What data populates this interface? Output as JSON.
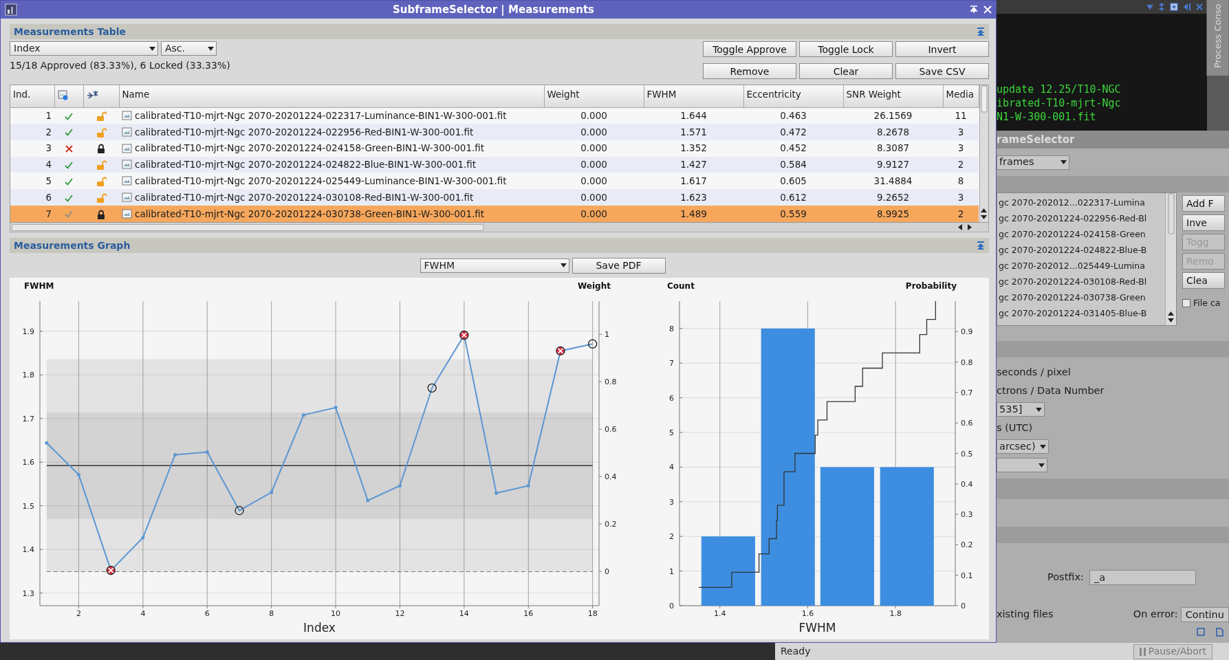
{
  "window": {
    "title": "SubframeSelector | Measurements"
  },
  "table_section": {
    "title": "Measurements Table",
    "sort_field": "Index",
    "sort_order": "Asc.",
    "buttons": [
      {
        "label": "Toggle Approve"
      },
      {
        "label": "Toggle Lock"
      },
      {
        "label": "Invert"
      },
      {
        "label": "Remove"
      },
      {
        "label": "Clear"
      },
      {
        "label": "Save CSV"
      }
    ],
    "summary": "15/18 Approved (83.33%), 6 Locked (33.33%)",
    "columns": [
      {
        "kind": "index",
        "label": "Ind."
      },
      {
        "kind": "approval"
      },
      {
        "kind": "lock"
      },
      {
        "kind": "file",
        "label": "Name"
      },
      {
        "kind": "value",
        "label": "Weight"
      },
      {
        "kind": "value",
        "label": "FWHM"
      },
      {
        "kind": "value",
        "label": "Eccentricity"
      },
      {
        "kind": "value",
        "label": "SNR Weight"
      },
      {
        "kind": "value",
        "label": "Media"
      }
    ],
    "rows": [
      {
        "approved": true,
        "locked": false,
        "selected": false,
        "cells": [
          "1",
          "",
          "",
          "calibrated-T10-mjrt-Ngc 2070-20201224-022317-Luminance-BIN1-W-300-001.fit",
          "0.000",
          "1.644",
          "0.463",
          "26.1569",
          "11"
        ]
      },
      {
        "approved": true,
        "locked": false,
        "selected": false,
        "cells": [
          "2",
          "",
          "",
          "calibrated-T10-mjrt-Ngc 2070-20201224-022956-Red-BIN1-W-300-001.fit",
          "0.000",
          "1.571",
          "0.472",
          "8.2678",
          "3"
        ]
      },
      {
        "approved": false,
        "locked": true,
        "selected": false,
        "cells": [
          "3",
          "",
          "",
          "calibrated-T10-mjrt-Ngc 2070-20201224-024158-Green-BIN1-W-300-001.fit",
          "0.000",
          "1.352",
          "0.452",
          "8.3087",
          "3"
        ]
      },
      {
        "approved": true,
        "locked": false,
        "selected": false,
        "cells": [
          "4",
          "",
          "",
          "calibrated-T10-mjrt-Ngc 2070-20201224-024822-Blue-BIN1-W-300-001.fit",
          "0.000",
          "1.427",
          "0.584",
          "9.9127",
          "2"
        ]
      },
      {
        "approved": true,
        "locked": false,
        "selected": false,
        "cells": [
          "5",
          "",
          "",
          "calibrated-T10-mjrt-Ngc 2070-20201224-025449-Luminance-BIN1-W-300-001.fit",
          "0.000",
          "1.617",
          "0.605",
          "31.4884",
          "8"
        ]
      },
      {
        "approved": true,
        "locked": false,
        "selected": false,
        "cells": [
          "6",
          "",
          "",
          "calibrated-T10-mjrt-Ngc 2070-20201224-030108-Red-BIN1-W-300-001.fit",
          "0.000",
          "1.623",
          "0.612",
          "9.2652",
          "3"
        ]
      },
      {
        "approved": true,
        "locked": true,
        "selected": true,
        "cells": [
          "7",
          "",
          "",
          "calibrated-T10-mjrt-Ngc 2070-20201224-030738-Green-BIN1-W-300-001.fit",
          "0.000",
          "1.489",
          "0.559",
          "8.9925",
          "2"
        ]
      }
    ]
  },
  "graph_section": {
    "title": "Measurements Graph",
    "property": "FWHM",
    "save_button": "Save PDF",
    "line_chart": {
      "chart_data": {
        "type": "line",
        "ylabel": "FWHM",
        "xlabel": "Index",
        "x": [
          1,
          2,
          3,
          4,
          5,
          6,
          7,
          8,
          9,
          10,
          11,
          12,
          13,
          14,
          15,
          16,
          17,
          18
        ],
        "series": [
          {
            "color": "#5b96d2",
            "values": [
              1.644,
              1.571,
              1.352,
              1.427,
              1.617,
              1.623,
              1.489,
              1.531,
              1.708,
              1.725,
              1.512,
              1.546,
              1.77,
              1.891,
              1.529,
              1.546,
              1.855,
              1.871
            ]
          }
        ],
        "xlim": [
          0.79,
          18.2
        ],
        "ylim": [
          1.271,
          1.969
        ],
        "xticks": [
          2,
          4,
          6,
          8,
          10,
          12,
          14,
          16,
          18
        ],
        "yticks": [
          1.3,
          1.4,
          1.5,
          1.6,
          1.7,
          1.8,
          1.9
        ],
        "y2label": "Weight",
        "y2lim": [
          -0.145,
          1.14
        ],
        "y2ticks": [
          0,
          0.2,
          0.4,
          0.6,
          0.8,
          1
        ],
        "grid": true,
        "ref_lines": [
          {
            "axis": "y",
            "value": 1.592
          },
          {
            "axis": "y",
            "value": 1.349
          }
        ],
        "bands": [
          {
            "axis": "y",
            "from": 1.349,
            "to": 1.836
          },
          {
            "axis": "y",
            "from": 1.47,
            "to": 1.714
          }
        ]
      },
      "points": [
        {
          "approved": true,
          "locked": false
        },
        {
          "approved": true,
          "locked": false
        },
        {
          "approved": false,
          "locked": true
        },
        {
          "approved": true,
          "locked": false
        },
        {
          "approved": true,
          "locked": false
        },
        {
          "approved": true,
          "locked": false
        },
        {
          "approved": true,
          "locked": true
        },
        {
          "approved": true,
          "locked": false
        },
        {
          "approved": true,
          "locked": false
        },
        {
          "approved": true,
          "locked": false
        },
        {
          "approved": true,
          "locked": false
        },
        {
          "approved": true,
          "locked": false
        },
        {
          "approved": true,
          "locked": true
        },
        {
          "approved": false,
          "locked": true
        },
        {
          "approved": true,
          "locked": false
        },
        {
          "approved": true,
          "locked": false
        },
        {
          "approved": false,
          "locked": true
        },
        {
          "approved": true,
          "locked": true
        }
      ]
    },
    "histogram": {
      "chart_data": {
        "type": "bar",
        "ylabel": "Count",
        "xlabel": "FWHM",
        "x": [
          1.419,
          1.555,
          1.69,
          1.826
        ],
        "series": [
          {
            "color": "#3d8ee0",
            "values": [
              2,
              8,
              4,
              4
            ]
          }
        ],
        "xlim": [
          1.308,
          1.936
        ],
        "ylim": [
          0,
          8.79
        ],
        "xticks": [
          1.4,
          1.6,
          1.8
        ],
        "yticks": [
          0,
          1,
          2,
          3,
          4,
          5,
          6,
          7,
          8
        ],
        "grid": true
      }
    },
    "cumulative": {
      "chart_data": {
        "type": "line",
        "ylabel": "Probability",
        "x": [
          1.352,
          1.427,
          1.427,
          1.489,
          1.489,
          1.512,
          1.512,
          1.529,
          1.529,
          1.531,
          1.531,
          1.546,
          1.546,
          1.571,
          1.571,
          1.617,
          1.617,
          1.623,
          1.623,
          1.644,
          1.644,
          1.708,
          1.708,
          1.725,
          1.725,
          1.77,
          1.77,
          1.855,
          1.855,
          1.871,
          1.871,
          1.891,
          1.891
        ],
        "series": [
          {
            "color": "#333333",
            "values": [
              0.06,
              0.06,
              0.11,
              0.11,
              0.17,
              0.17,
              0.22,
              0.22,
              0.28,
              0.28,
              0.33,
              0.33,
              0.44,
              0.44,
              0.5,
              0.5,
              0.56,
              0.56,
              0.61,
              0.61,
              0.67,
              0.67,
              0.72,
              0.72,
              0.78,
              0.78,
              0.83,
              0.83,
              0.89,
              0.89,
              0.94,
              0.94,
              1
            ]
          }
        ],
        "xlim": [
          1.308,
          1.936
        ],
        "ylim": [
          0,
          1
        ],
        "yticks": [
          0,
          0.1,
          0.2,
          0.3,
          0.4,
          0.5,
          0.6,
          0.7,
          0.8,
          0.9
        ]
      }
    }
  },
  "background_window": {
    "side_tab": "Process Conso",
    "console_lines": [
      "update 12.25/T10-NGC",
      "ibrated-T10-mjrt-Ngc",
      "N1-W-300-001.fit"
    ],
    "panel_title": "rameSelector",
    "mode_select": "frames",
    "files": [
      "gc 2070-202012...022317-Lumina",
      "gc 2070-20201224-022956-Red-Bl",
      "gc 2070-20201224-024158-Green",
      "gc 2070-20201224-024822-Blue-B",
      "gc 2070-202012...025449-Lumina",
      "gc 2070-20201224-030108-Red-Bl",
      "gc 2070-20201224-030738-Green",
      "gc 2070-20201224-031405-Blue-B"
    ],
    "side_buttons": [
      {
        "label": "Add F",
        "disabled": false
      },
      {
        "label": "Inve",
        "disabled": false
      },
      {
        "label": "Togg",
        "disabled": true
      },
      {
        "label": "Remo",
        "disabled": true
      },
      {
        "label": "Clea",
        "disabled": false
      }
    ],
    "cache_checkbox": {
      "label": "File ca",
      "checked": false
    },
    "settings": [
      {
        "kind": "text",
        "text": "seconds / pixel"
      },
      {
        "kind": "text",
        "text": "ctrons / Data Number"
      },
      {
        "kind": "select",
        "text": "535]"
      },
      {
        "kind": "text",
        "text": "s (UTC)"
      },
      {
        "kind": "select",
        "text": "arcsec)"
      },
      {
        "kind": "select"
      }
    ],
    "postfix": {
      "label": "Postfix:",
      "value": "_a"
    },
    "overwrite_label": "xisting files",
    "on_error": {
      "label": "On error:",
      "value": "Continu"
    }
  },
  "status_bar": {
    "text": "Ready",
    "button": "Pause/Abort"
  }
}
